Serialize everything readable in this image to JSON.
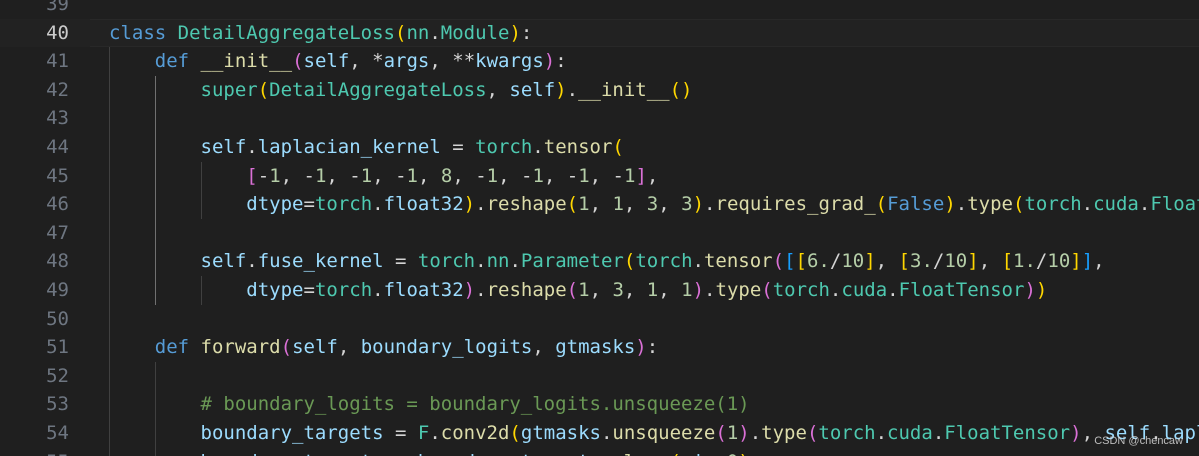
{
  "editor": {
    "language": "python",
    "active_line": "40",
    "lines": [
      {
        "number": "39",
        "tokens": []
      },
      {
        "number": "40",
        "tokens": [
          {
            "t": "class",
            "c": "keyword"
          },
          {
            "t": " ",
            "c": "op"
          },
          {
            "t": "DetailAggregateLoss",
            "c": "class"
          },
          {
            "t": "(",
            "c": "bracket1"
          },
          {
            "t": "nn",
            "c": "class"
          },
          {
            "t": ".",
            "c": "op"
          },
          {
            "t": "Module",
            "c": "class"
          },
          {
            "t": ")",
            "c": "bracket1"
          },
          {
            "t": ":",
            "c": "op"
          }
        ]
      },
      {
        "number": "41",
        "tokens": [
          {
            "t": "    ",
            "c": "op"
          },
          {
            "t": "def",
            "c": "keyword"
          },
          {
            "t": " ",
            "c": "op"
          },
          {
            "t": "__init__",
            "c": "func"
          },
          {
            "t": "(",
            "c": "bracket2"
          },
          {
            "t": "self",
            "c": "var"
          },
          {
            "t": ", *",
            "c": "op"
          },
          {
            "t": "args",
            "c": "var"
          },
          {
            "t": ", **",
            "c": "op"
          },
          {
            "t": "kwargs",
            "c": "var"
          },
          {
            "t": ")",
            "c": "bracket2"
          },
          {
            "t": ":",
            "c": "op"
          }
        ]
      },
      {
        "number": "42",
        "tokens": [
          {
            "t": "        ",
            "c": "op"
          },
          {
            "t": "super",
            "c": "class"
          },
          {
            "t": "(",
            "c": "bracket1"
          },
          {
            "t": "DetailAggregateLoss",
            "c": "class"
          },
          {
            "t": ", ",
            "c": "op"
          },
          {
            "t": "self",
            "c": "var"
          },
          {
            "t": ")",
            "c": "bracket1"
          },
          {
            "t": ".",
            "c": "op"
          },
          {
            "t": "__init__",
            "c": "func"
          },
          {
            "t": "()",
            "c": "bracket1"
          }
        ]
      },
      {
        "number": "43",
        "tokens": []
      },
      {
        "number": "44",
        "tokens": [
          {
            "t": "        ",
            "c": "op"
          },
          {
            "t": "self",
            "c": "var"
          },
          {
            "t": ".",
            "c": "op"
          },
          {
            "t": "laplacian_kernel",
            "c": "var"
          },
          {
            "t": " = ",
            "c": "op"
          },
          {
            "t": "torch",
            "c": "class"
          },
          {
            "t": ".",
            "c": "op"
          },
          {
            "t": "tensor",
            "c": "func"
          },
          {
            "t": "(",
            "c": "bracket1"
          }
        ]
      },
      {
        "number": "45",
        "tokens": [
          {
            "t": "            ",
            "c": "op"
          },
          {
            "t": "[",
            "c": "bracket2"
          },
          {
            "t": "-",
            "c": "op"
          },
          {
            "t": "1",
            "c": "number"
          },
          {
            "t": ", -",
            "c": "op"
          },
          {
            "t": "1",
            "c": "number"
          },
          {
            "t": ", -",
            "c": "op"
          },
          {
            "t": "1",
            "c": "number"
          },
          {
            "t": ", -",
            "c": "op"
          },
          {
            "t": "1",
            "c": "number"
          },
          {
            "t": ", ",
            "c": "op"
          },
          {
            "t": "8",
            "c": "number"
          },
          {
            "t": ", -",
            "c": "op"
          },
          {
            "t": "1",
            "c": "number"
          },
          {
            "t": ", -",
            "c": "op"
          },
          {
            "t": "1",
            "c": "number"
          },
          {
            "t": ", -",
            "c": "op"
          },
          {
            "t": "1",
            "c": "number"
          },
          {
            "t": ", -",
            "c": "op"
          },
          {
            "t": "1",
            "c": "number"
          },
          {
            "t": "]",
            "c": "bracket2"
          },
          {
            "t": ",",
            "c": "op"
          }
        ]
      },
      {
        "number": "46",
        "tokens": [
          {
            "t": "            ",
            "c": "op"
          },
          {
            "t": "dtype",
            "c": "var"
          },
          {
            "t": "=",
            "c": "op"
          },
          {
            "t": "torch",
            "c": "class"
          },
          {
            "t": ".",
            "c": "op"
          },
          {
            "t": "float32",
            "c": "var"
          },
          {
            "t": ")",
            "c": "bracket1"
          },
          {
            "t": ".",
            "c": "op"
          },
          {
            "t": "reshape",
            "c": "func"
          },
          {
            "t": "(",
            "c": "bracket1"
          },
          {
            "t": "1",
            "c": "number"
          },
          {
            "t": ", ",
            "c": "op"
          },
          {
            "t": "1",
            "c": "number"
          },
          {
            "t": ", ",
            "c": "op"
          },
          {
            "t": "3",
            "c": "number"
          },
          {
            "t": ", ",
            "c": "op"
          },
          {
            "t": "3",
            "c": "number"
          },
          {
            "t": ")",
            "c": "bracket1"
          },
          {
            "t": ".",
            "c": "op"
          },
          {
            "t": "requires_grad_",
            "c": "func"
          },
          {
            "t": "(",
            "c": "bracket1"
          },
          {
            "t": "False",
            "c": "keyword"
          },
          {
            "t": ")",
            "c": "bracket1"
          },
          {
            "t": ".",
            "c": "op"
          },
          {
            "t": "type",
            "c": "func"
          },
          {
            "t": "(",
            "c": "bracket1"
          },
          {
            "t": "torch",
            "c": "class"
          },
          {
            "t": ".",
            "c": "op"
          },
          {
            "t": "cuda",
            "c": "class"
          },
          {
            "t": ".",
            "c": "op"
          },
          {
            "t": "FloatTensor",
            "c": "class"
          },
          {
            "t": "))",
            "c": "bracket1"
          }
        ]
      },
      {
        "number": "47",
        "tokens": []
      },
      {
        "number": "48",
        "tokens": [
          {
            "t": "        ",
            "c": "op"
          },
          {
            "t": "self",
            "c": "var"
          },
          {
            "t": ".",
            "c": "op"
          },
          {
            "t": "fuse_kernel",
            "c": "var"
          },
          {
            "t": " = ",
            "c": "op"
          },
          {
            "t": "torch",
            "c": "class"
          },
          {
            "t": ".",
            "c": "op"
          },
          {
            "t": "nn",
            "c": "class"
          },
          {
            "t": ".",
            "c": "op"
          },
          {
            "t": "Parameter",
            "c": "class"
          },
          {
            "t": "(",
            "c": "bracket1"
          },
          {
            "t": "torch",
            "c": "class"
          },
          {
            "t": ".",
            "c": "op"
          },
          {
            "t": "tensor",
            "c": "func"
          },
          {
            "t": "(",
            "c": "bracket2"
          },
          {
            "t": "[",
            "c": "bracket3"
          },
          {
            "t": "[",
            "c": "bracket1"
          },
          {
            "t": "6.",
            "c": "number"
          },
          {
            "t": "/",
            "c": "op"
          },
          {
            "t": "10",
            "c": "number"
          },
          {
            "t": "]",
            "c": "bracket1"
          },
          {
            "t": ", ",
            "c": "op"
          },
          {
            "t": "[",
            "c": "bracket1"
          },
          {
            "t": "3.",
            "c": "number"
          },
          {
            "t": "/",
            "c": "op"
          },
          {
            "t": "10",
            "c": "number"
          },
          {
            "t": "]",
            "c": "bracket1"
          },
          {
            "t": ", ",
            "c": "op"
          },
          {
            "t": "[",
            "c": "bracket1"
          },
          {
            "t": "1.",
            "c": "number"
          },
          {
            "t": "/",
            "c": "op"
          },
          {
            "t": "10",
            "c": "number"
          },
          {
            "t": "]",
            "c": "bracket1"
          },
          {
            "t": "]",
            "c": "bracket3"
          },
          {
            "t": ",",
            "c": "op"
          }
        ]
      },
      {
        "number": "49",
        "tokens": [
          {
            "t": "            ",
            "c": "op"
          },
          {
            "t": "dtype",
            "c": "var"
          },
          {
            "t": "=",
            "c": "op"
          },
          {
            "t": "torch",
            "c": "class"
          },
          {
            "t": ".",
            "c": "op"
          },
          {
            "t": "float32",
            "c": "var"
          },
          {
            "t": ")",
            "c": "bracket2"
          },
          {
            "t": ".",
            "c": "op"
          },
          {
            "t": "reshape",
            "c": "func"
          },
          {
            "t": "(",
            "c": "bracket2"
          },
          {
            "t": "1",
            "c": "number"
          },
          {
            "t": ", ",
            "c": "op"
          },
          {
            "t": "3",
            "c": "number"
          },
          {
            "t": ", ",
            "c": "op"
          },
          {
            "t": "1",
            "c": "number"
          },
          {
            "t": ", ",
            "c": "op"
          },
          {
            "t": "1",
            "c": "number"
          },
          {
            "t": ")",
            "c": "bracket2"
          },
          {
            "t": ".",
            "c": "op"
          },
          {
            "t": "type",
            "c": "func"
          },
          {
            "t": "(",
            "c": "bracket2"
          },
          {
            "t": "torch",
            "c": "class"
          },
          {
            "t": ".",
            "c": "op"
          },
          {
            "t": "cuda",
            "c": "class"
          },
          {
            "t": ".",
            "c": "op"
          },
          {
            "t": "FloatTensor",
            "c": "class"
          },
          {
            "t": ")",
            "c": "bracket2"
          },
          {
            "t": ")",
            "c": "bracket1"
          }
        ]
      },
      {
        "number": "50",
        "tokens": []
      },
      {
        "number": "51",
        "tokens": [
          {
            "t": "    ",
            "c": "op"
          },
          {
            "t": "def",
            "c": "keyword"
          },
          {
            "t": " ",
            "c": "op"
          },
          {
            "t": "forward",
            "c": "func"
          },
          {
            "t": "(",
            "c": "bracket2"
          },
          {
            "t": "self",
            "c": "var"
          },
          {
            "t": ", ",
            "c": "op"
          },
          {
            "t": "boundary_logits",
            "c": "var"
          },
          {
            "t": ", ",
            "c": "op"
          },
          {
            "t": "gtmasks",
            "c": "var"
          },
          {
            "t": ")",
            "c": "bracket2"
          },
          {
            "t": ":",
            "c": "op"
          }
        ]
      },
      {
        "number": "52",
        "tokens": []
      },
      {
        "number": "53",
        "tokens": [
          {
            "t": "        ",
            "c": "op"
          },
          {
            "t": "# boundary_logits = boundary_logits.unsqueeze(1)",
            "c": "comment"
          }
        ]
      },
      {
        "number": "54",
        "tokens": [
          {
            "t": "        ",
            "c": "op"
          },
          {
            "t": "boundary_targets",
            "c": "var"
          },
          {
            "t": " = ",
            "c": "op"
          },
          {
            "t": "F",
            "c": "class"
          },
          {
            "t": ".",
            "c": "op"
          },
          {
            "t": "conv2d",
            "c": "func"
          },
          {
            "t": "(",
            "c": "bracket1"
          },
          {
            "t": "gtmasks",
            "c": "var"
          },
          {
            "t": ".",
            "c": "op"
          },
          {
            "t": "unsqueeze",
            "c": "func"
          },
          {
            "t": "(",
            "c": "bracket2"
          },
          {
            "t": "1",
            "c": "number"
          },
          {
            "t": ")",
            "c": "bracket2"
          },
          {
            "t": ".",
            "c": "op"
          },
          {
            "t": "type",
            "c": "func"
          },
          {
            "t": "(",
            "c": "bracket2"
          },
          {
            "t": "torch",
            "c": "class"
          },
          {
            "t": ".",
            "c": "op"
          },
          {
            "t": "cuda",
            "c": "class"
          },
          {
            "t": ".",
            "c": "op"
          },
          {
            "t": "FloatTensor",
            "c": "class"
          },
          {
            "t": ")",
            "c": "bracket2"
          },
          {
            "t": ", ",
            "c": "op"
          },
          {
            "t": "self",
            "c": "var"
          },
          {
            "t": ".",
            "c": "op"
          },
          {
            "t": "laplacian_kernel",
            "c": "var"
          }
        ]
      },
      {
        "number": "55",
        "tokens": [
          {
            "t": "        ",
            "c": "op"
          },
          {
            "t": "boundary_targets",
            "c": "var"
          },
          {
            "t": " = ",
            "c": "op"
          },
          {
            "t": "boundary_targets",
            "c": "var"
          },
          {
            "t": ".",
            "c": "op"
          },
          {
            "t": "clamp",
            "c": "func"
          },
          {
            "t": "(",
            "c": "bracket1"
          },
          {
            "t": "min",
            "c": "var"
          },
          {
            "t": "=",
            "c": "op"
          },
          {
            "t": "0",
            "c": "number"
          },
          {
            "t": ")",
            "c": "bracket1"
          }
        ]
      }
    ]
  },
  "watermark": {
    "text": "CSDN @chencaw"
  }
}
